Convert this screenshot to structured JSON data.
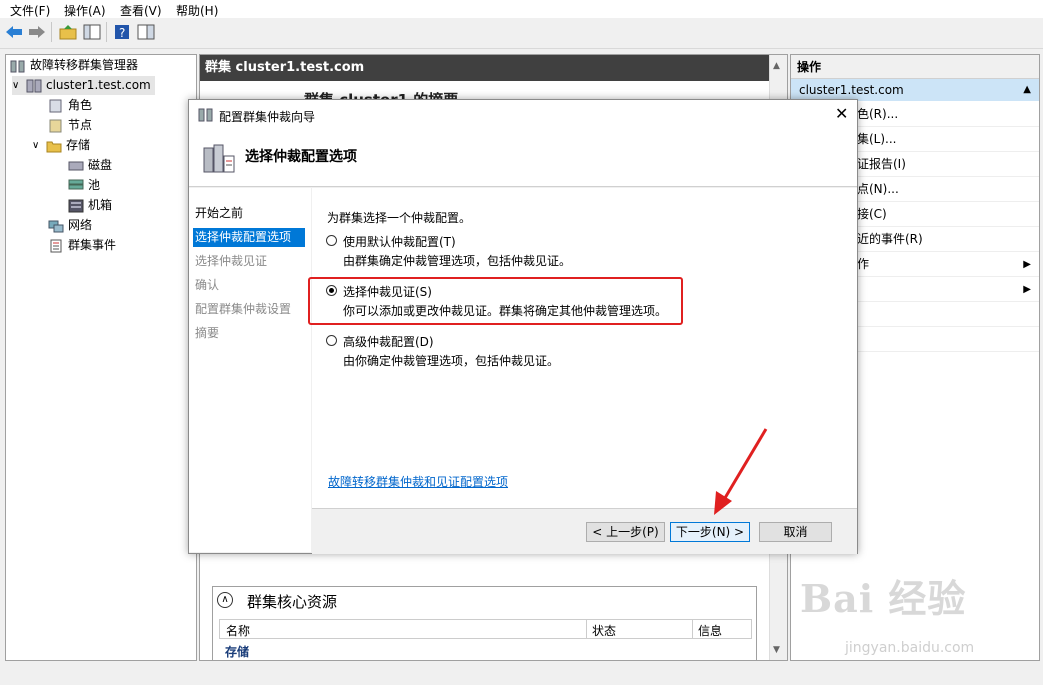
{
  "menubar": {
    "file": "文件(F)",
    "action": "操作(A)",
    "view": "查看(V)",
    "help": "帮助(H)"
  },
  "tree": {
    "root": "故障转移群集管理器",
    "cluster": "cluster1.test.com",
    "roles": "角色",
    "nodes": "节点",
    "storage": "存储",
    "disks": "磁盘",
    "pools": "池",
    "enclosures": "机箱",
    "networks": "网络",
    "events": "群集事件"
  },
  "center": {
    "header": "群集 cluster1.test.com",
    "behind_title": "群集 cluster1 的摘要",
    "core_title": "群集核心资源",
    "core_cols": [
      "名称",
      "状态",
      "信息"
    ],
    "core_row": "存储"
  },
  "actions": {
    "header": "操作",
    "sub": "cluster1.test.com",
    "items": [
      "色(R)...",
      "集(L)...",
      "证报告(I)",
      "点(N)...",
      "接(C)",
      "近的事件(R)",
      "作",
      "",
      "",
      ""
    ]
  },
  "dialog": {
    "title": "配置群集仲裁向导",
    "header": "选择仲裁配置选项",
    "nav": [
      "开始之前",
      "选择仲裁配置选项",
      "选择仲裁见证",
      "确认",
      "配置群集仲裁设置",
      "摘要"
    ],
    "nav_selected_index": 1,
    "prompt": "为群集选择一个仲裁配置。",
    "options": [
      {
        "title": "使用默认仲裁配置(T)",
        "desc": "由群集确定仲裁管理选项，包括仲裁见证。",
        "selected": false
      },
      {
        "title": "选择仲裁见证(S)",
        "desc": "你可以添加或更改仲裁见证。群集将确定其他仲裁管理选项。",
        "selected": true
      },
      {
        "title": "高级仲裁配置(D)",
        "desc": "由你确定仲裁管理选项，包括仲裁见证。",
        "selected": false
      }
    ],
    "link": "故障转移群集仲裁和见证配置选项",
    "prev_button": "< 上一步(P)",
    "next_button": "下一步(N) >",
    "cancel_button": "取消"
  },
  "watermark": {
    "brand": "Bai 经验",
    "url": "jingyan.baidu.com"
  },
  "colors": {
    "selection": "#0078d7",
    "highlight_box": "#e02020",
    "arrow": "#e02020",
    "link": "#0066cc"
  }
}
